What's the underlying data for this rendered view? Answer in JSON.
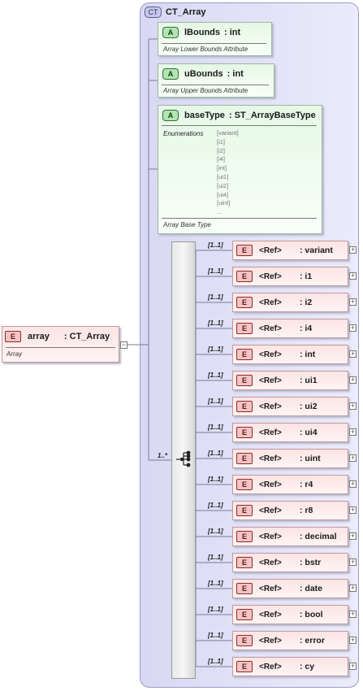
{
  "complex_type": {
    "badge": "CT",
    "name": "CT_Array"
  },
  "main_element": {
    "badge": "E",
    "name": "array",
    "type": ": CT_Array",
    "description": "Array"
  },
  "attributes": [
    {
      "badge": "A",
      "name": "lBounds",
      "type": ": int",
      "description": "Array Lower Bounds Attribute"
    },
    {
      "badge": "A",
      "name": "uBounds",
      "type": ": int",
      "description": "Array Upper Bounds Attribute"
    },
    {
      "badge": "A",
      "name": "baseType",
      "type": ": ST_ArrayBaseType",
      "description": "Array Base Type",
      "enumerations_label": "Enumerations",
      "enumerations": [
        "[variant]",
        "[i1]",
        "[i2]",
        "[i4]",
        "[int]",
        "[ui1]",
        "[ui2]",
        "[ui4]",
        "[uint]",
        "..."
      ]
    }
  ],
  "choice": {
    "cardinality": "1..*"
  },
  "refs": [
    {
      "badge": "E",
      "tag": "<Ref>",
      "name": ": variant",
      "cardinality": "[1..1]"
    },
    {
      "badge": "E",
      "tag": "<Ref>",
      "name": ": i1",
      "cardinality": "[1..1]"
    },
    {
      "badge": "E",
      "tag": "<Ref>",
      "name": ": i2",
      "cardinality": "[1..1]"
    },
    {
      "badge": "E",
      "tag": "<Ref>",
      "name": ": i4",
      "cardinality": "[1..1]"
    },
    {
      "badge": "E",
      "tag": "<Ref>",
      "name": ": int",
      "cardinality": "[1..1]"
    },
    {
      "badge": "E",
      "tag": "<Ref>",
      "name": ": ui1",
      "cardinality": "[1..1]"
    },
    {
      "badge": "E",
      "tag": "<Ref>",
      "name": ": ui2",
      "cardinality": "[1..1]"
    },
    {
      "badge": "E",
      "tag": "<Ref>",
      "name": ": ui4",
      "cardinality": "[1..1]"
    },
    {
      "badge": "E",
      "tag": "<Ref>",
      "name": ": uint",
      "cardinality": "[1..1]"
    },
    {
      "badge": "E",
      "tag": "<Ref>",
      "name": ": r4",
      "cardinality": "[1..1]"
    },
    {
      "badge": "E",
      "tag": "<Ref>",
      "name": ": r8",
      "cardinality": "[1..1]"
    },
    {
      "badge": "E",
      "tag": "<Ref>",
      "name": ": decimal",
      "cardinality": "[1..1]"
    },
    {
      "badge": "E",
      "tag": "<Ref>",
      "name": ": bstr",
      "cardinality": "[1..1]"
    },
    {
      "badge": "E",
      "tag": "<Ref>",
      "name": ": date",
      "cardinality": "[1..1]"
    },
    {
      "badge": "E",
      "tag": "<Ref>",
      "name": ": bool",
      "cardinality": "[1..1]"
    },
    {
      "badge": "E",
      "tag": "<Ref>",
      "name": ": error",
      "cardinality": "[1..1]"
    },
    {
      "badge": "E",
      "tag": "<Ref>",
      "name": ": cy",
      "cardinality": "[1..1]"
    }
  ],
  "colors": {
    "complex_type_fill": "#e3e3f8",
    "attribute_fill": "#eefaee",
    "element_fill": "#fdeaea",
    "connector": "#7a7a9a"
  }
}
